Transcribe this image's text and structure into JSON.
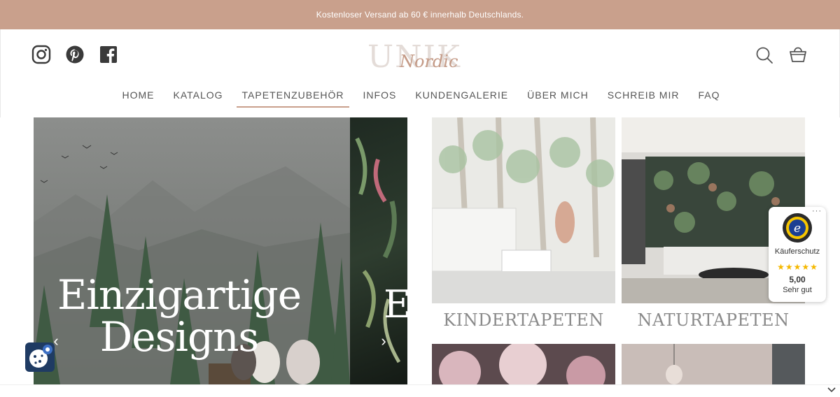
{
  "announcement": "Kostenloser Versand ab 60 € innerhalb Deutschlands.",
  "logo": {
    "main": "UNIK",
    "script": "Nordic"
  },
  "nav": {
    "items": [
      {
        "label": "HOME"
      },
      {
        "label": "KATALOG"
      },
      {
        "label": "TAPETENZUBEHÖR",
        "active": true
      },
      {
        "label": "INFOS"
      },
      {
        "label": "KUNDENGALERIE"
      },
      {
        "label": "ÜBER MICH"
      },
      {
        "label": "SCHREIB MIR"
      },
      {
        "label": "FAQ"
      }
    ]
  },
  "icons": {
    "social": [
      "instagram-icon",
      "pinterest-icon",
      "facebook-icon"
    ],
    "header": [
      "search-icon",
      "cart-icon"
    ]
  },
  "hero": {
    "title": "Einzigartige Designs",
    "next_slide_title": "E",
    "prev_arrow": "‹",
    "next_arrow": "›"
  },
  "tiles": [
    {
      "label": "KINDERTAPETEN"
    },
    {
      "label": "NATURTAPETEN"
    }
  ],
  "trust_badge": {
    "dots": "···",
    "title": "Käuferschutz",
    "rating": "5,00",
    "rating_text": "Sehr gut",
    "stars": 5
  },
  "colors": {
    "accent": "#c9a08c",
    "cookie_button": "#1f3b63",
    "star": "#f5b800"
  }
}
